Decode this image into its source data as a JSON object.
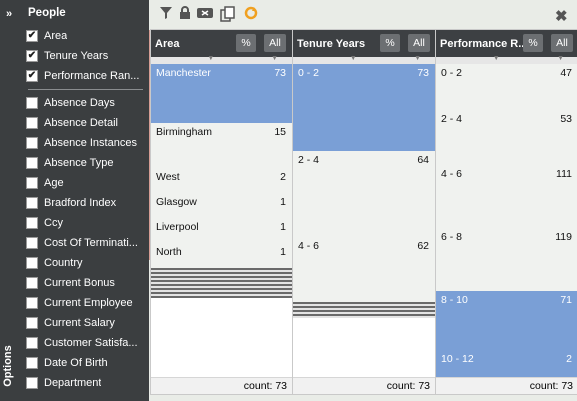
{
  "options_label": "Options",
  "expand_label": "»",
  "fields": {
    "header": "People",
    "selected": [
      {
        "label": "Area",
        "checked": true
      },
      {
        "label": "Tenure Years",
        "checked": true
      },
      {
        "label": "Performance Ran...",
        "checked": true
      }
    ],
    "available": [
      {
        "label": "Absence Days",
        "checked": false
      },
      {
        "label": "Absence Detail",
        "checked": false
      },
      {
        "label": "Absence Instances",
        "checked": false
      },
      {
        "label": "Absence Type",
        "checked": false
      },
      {
        "label": "Age",
        "checked": false
      },
      {
        "label": "Bradford Index",
        "checked": false
      },
      {
        "label": "Ccy",
        "checked": false
      },
      {
        "label": "Cost Of Terminati...",
        "checked": false
      },
      {
        "label": "Country",
        "checked": false
      },
      {
        "label": "Current Bonus",
        "checked": false
      },
      {
        "label": "Current Employee",
        "checked": false
      },
      {
        "label": "Current Salary",
        "checked": false
      },
      {
        "label": "Customer Satisfa...",
        "checked": false
      },
      {
        "label": "Date Of Birth",
        "checked": false
      },
      {
        "label": "Department",
        "checked": false
      }
    ]
  },
  "toolbar": {
    "icons": [
      "filter-icon",
      "lock-icon",
      "clear-icon",
      "copy-icon",
      "refresh-icon"
    ],
    "close_label": "✖"
  },
  "colors": {
    "selected_bar": "#7a9fd6",
    "unselected_bar": "#f0f2ef",
    "header": "#3d4043"
  },
  "columns": [
    {
      "title": "Area",
      "pct_label": "%",
      "all_label": "All",
      "count_label": "count: 73",
      "bars": [
        {
          "name": "Manchester",
          "count": "73",
          "selected": true
        },
        {
          "name": "Birmingham",
          "count": "15",
          "selected": false
        },
        {
          "name": "West",
          "count": "2",
          "selected": false
        },
        {
          "name": "Glasgow",
          "count": "1",
          "selected": false
        },
        {
          "name": "Liverpool",
          "count": "1",
          "selected": false
        },
        {
          "name": "North",
          "count": "1",
          "selected": false
        }
      ]
    },
    {
      "title": "Tenure Years",
      "pct_label": "%",
      "all_label": "All",
      "count_label": "count: 73",
      "bars": [
        {
          "name": "0 - 2",
          "count": "73",
          "selected": true
        },
        {
          "name": "2 - 4",
          "count": "64",
          "selected": false
        },
        {
          "name": "4 - 6",
          "count": "62",
          "selected": false
        }
      ]
    },
    {
      "title": "Performance R...",
      "pct_label": "%",
      "all_label": "All",
      "count_label": "count: 73",
      "bars": [
        {
          "name": "0 - 2",
          "count": "47",
          "selected": false
        },
        {
          "name": "2 - 4",
          "count": "53",
          "selected": false
        },
        {
          "name": "4 - 6",
          "count": "111",
          "selected": false
        },
        {
          "name": "6 - 8",
          "count": "119",
          "selected": false
        },
        {
          "name": "8 - 10",
          "count": "71",
          "selected": true
        },
        {
          "name": "10 - 12",
          "count": "2",
          "selected": true
        }
      ]
    }
  ]
}
